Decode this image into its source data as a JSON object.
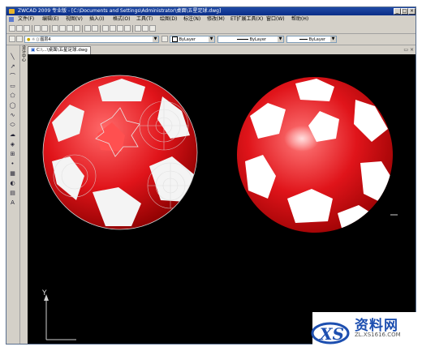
{
  "window": {
    "title": "ZWCAD 2009 专业版 - [C:\\Documents and Settings\\Administrator\\桌面\\五星足球.dwg]"
  },
  "menu": {
    "items": [
      "文件(F)",
      "编辑(E)",
      "视图(V)",
      "插入(I)",
      "格式(O)",
      "工具(T)",
      "绘图(D)",
      "标注(N)",
      "修改(M)",
      "ET扩展工具(X)",
      "窗口(W)",
      "帮助(H)"
    ]
  },
  "layers": {
    "current": "图层4"
  },
  "properties": {
    "color": "ByLayer",
    "linetype": "ByLayer",
    "lineweight": "ByLayer"
  },
  "sidebar_vertical_text": "设计中心",
  "tab": {
    "label": "C:\\...\\桌面\\五星足球.dwg"
  },
  "axis": {
    "y_label": "Y"
  },
  "watermark": {
    "text": "资料网",
    "url": "ZL.XS1616.COM"
  },
  "colors": {
    "ball_red": "#e0141a",
    "panel_white": "#ffffff",
    "canvas": "#000000",
    "title_blue": "#0a2d87"
  },
  "icons": {
    "left_toolbar": [
      "line-icon",
      "polyline-icon",
      "arc-icon",
      "rectangle-icon",
      "polygon-icon",
      "circle-icon",
      "spline-icon",
      "ellipse-icon",
      "revcloud-icon",
      "block-icon",
      "insert-icon",
      "point-icon",
      "hatch-icon",
      "region-icon",
      "table-icon",
      "text-icon"
    ]
  }
}
